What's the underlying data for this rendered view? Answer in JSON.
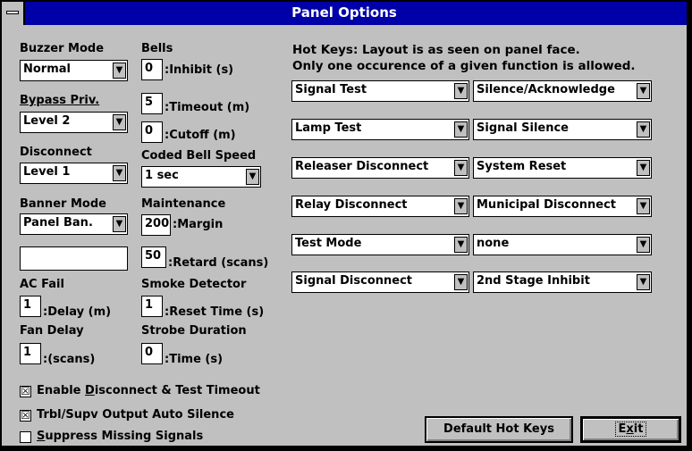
{
  "window": {
    "title": "Panel Options"
  },
  "left": {
    "buzzer_mode": {
      "label": "Buzzer Mode",
      "value": "Normal"
    },
    "bypass_priv": {
      "label": "Bypass Priv.",
      "value": "Level 2"
    },
    "disconnect": {
      "label": "Disconnect",
      "value": "Level 1"
    },
    "banner_mode": {
      "label": "Banner Mode",
      "value": "Panel Ban.",
      "text": ""
    },
    "ac_fail": {
      "label": "AC Fail",
      "value": "1",
      "suffix": ":Delay (m)"
    },
    "fan_delay": {
      "label": "Fan Delay",
      "value": "1",
      "suffix": ":(scans)"
    }
  },
  "middle": {
    "bells": {
      "label": "Bells",
      "inhibit": {
        "value": "0",
        "suffix": ":Inhibit (s)"
      },
      "timeout": {
        "value": "5",
        "suffix": ":Timeout (m)"
      },
      "cutoff": {
        "value": "0",
        "suffix": ":Cutoff (m)"
      }
    },
    "coded_bell_speed": {
      "label": "Coded Bell Speed",
      "value": "1 sec"
    },
    "maintenance": {
      "label": "Maintenance",
      "margin": {
        "value": "200",
        "suffix": ":Margin"
      },
      "retard": {
        "value": "50",
        "suffix": ":Retard (scans)"
      }
    },
    "smoke_detector": {
      "label": "Smoke Detector",
      "value": "1",
      "suffix": ":Reset Time (s)"
    },
    "strobe_duration": {
      "label": "Strobe Duration",
      "value": "0",
      "suffix": ":Time (s)"
    }
  },
  "hotkeys": {
    "line1": "Hot Keys: Layout is as seen on panel face.",
    "line2": "Only one occurence of a given function is allowed.",
    "items": [
      "Signal Test",
      "Silence/Acknowledge",
      "Lamp Test",
      "Signal Silence",
      "Releaser Disconnect",
      "System Reset",
      "Relay Disconnect",
      "Municipal Disconnect",
      "Test Mode",
      "none",
      "Signal Disconnect",
      "2nd Stage Inhibit"
    ]
  },
  "checkboxes": {
    "enable_disconnect": {
      "pre": "Enable ",
      "u": "D",
      "post": "isconnect & Test Timeout",
      "checked": "☒"
    },
    "trbl_supv": {
      "label": "Trbl/Supv Output Auto Silence",
      "checked": "☒"
    },
    "suppress": {
      "u": "S",
      "post": "uppress Missing Signals",
      "checked": ""
    }
  },
  "buttons": {
    "default_hot_keys": "Default Hot Keys",
    "exit_pre": "E",
    "exit_u": "x",
    "exit_post": "it"
  },
  "icons": {
    "dropdown": "▼",
    "checkbox_checked": "☒"
  }
}
